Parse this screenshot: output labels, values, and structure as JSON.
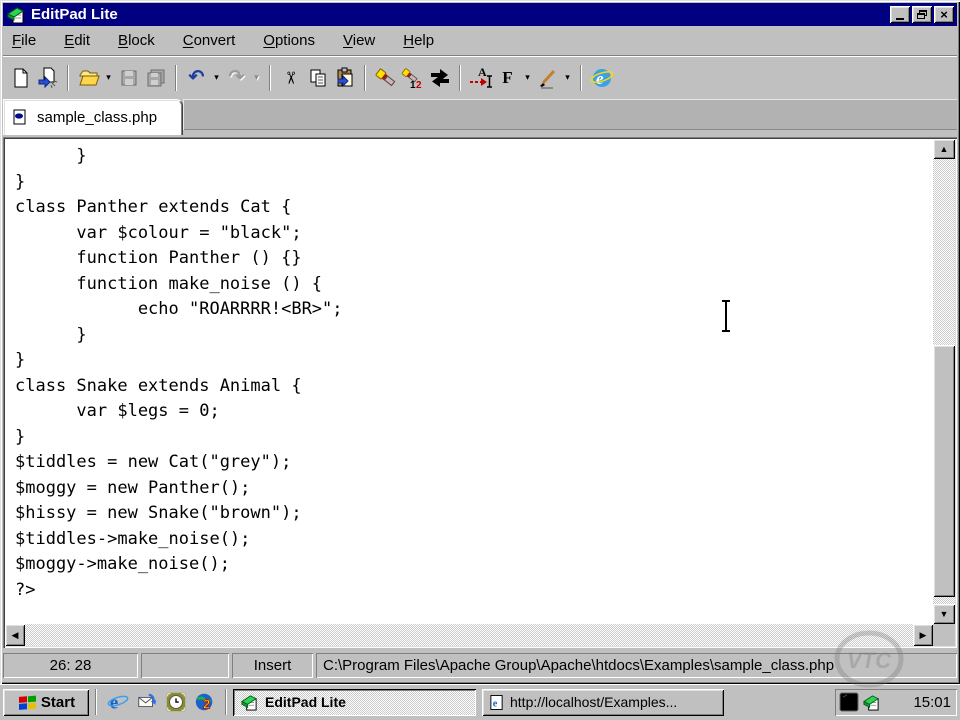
{
  "window": {
    "title": "EditPad Lite"
  },
  "menu_bar": {
    "items": [
      {
        "key": "F",
        "rest": "ile"
      },
      {
        "key": "E",
        "rest": "dit"
      },
      {
        "key": "B",
        "rest": "lock"
      },
      {
        "key": "C",
        "rest": "onvert"
      },
      {
        "key": "O",
        "rest": "ptions"
      },
      {
        "key": "V",
        "rest": "iew"
      },
      {
        "key": "H",
        "rest": "elp"
      }
    ]
  },
  "toolbar": {
    "font_letter": "F",
    "goto_letter": "A",
    "find_badge_1": "1",
    "find_badge_2": "2"
  },
  "tab": {
    "label": "sample_class.php"
  },
  "editor": {
    "lines": [
      "      }",
      "}",
      "class Panther extends Cat {",
      "      var $colour = \"black\";",
      "      function Panther () {}",
      "      function make_noise () {",
      "            echo \"ROARRRR!<BR>\";",
      "      }",
      "}",
      "class Snake extends Animal {",
      "      var $legs = 0;",
      "}",
      "$tiddles = new Cat(\"grey\");",
      "$moggy = new Panther();",
      "$hissy = new Snake(\"brown\");",
      "$tiddles->make_noise();",
      "$moggy->make_noise();",
      "?>"
    ]
  },
  "status_bar": {
    "cursor_position": "26: 28",
    "panel2": "",
    "mode": "Insert",
    "file_path": "C:\\Program Files\\Apache Group\\Apache\\htdocs\\Examples\\sample_class.php"
  },
  "taskbar": {
    "start_label": "Start",
    "tasks": [
      {
        "label": "EditPad Lite",
        "active": true
      },
      {
        "label": "http://localhost/Examples...",
        "active": false
      }
    ],
    "clock": "15:01"
  },
  "watermark": {
    "text": "VTC"
  },
  "icons": {
    "editpad": "green-notebook-shape",
    "tab_document": "page-with-oval-shape",
    "new_document": "blank-page-shape",
    "new_window_document": "page-blue-arrow-shape",
    "open_folder": "yellow-folder-shape",
    "save": "grey-floppy-shape",
    "save_all": "grey-floppy-stack-shape",
    "undo": "↶",
    "redo": "↷",
    "cut": "✂",
    "copy": "two-pages-shape",
    "paste": "clipboard-shape",
    "find": "flashlight-shape",
    "find_next": "flashlight-12-shape",
    "replace": "black-swap-arrows-shape",
    "goto": "red-dashed-arrow-A-shape",
    "pen": "pencil-shape",
    "browser": "ie-globe-shape",
    "dropdown": "▾",
    "scroll_up": "▲",
    "scroll_down": "▼",
    "scroll_left": "◀",
    "scroll_right": "▶",
    "close": "×",
    "windows_flag": "four-color-flag-shape",
    "mail": "envelope-arrows-shape",
    "channels_clock": "olive-clock-shape",
    "world": "globe-2-shape",
    "tray_display": "black-screen-shape"
  }
}
